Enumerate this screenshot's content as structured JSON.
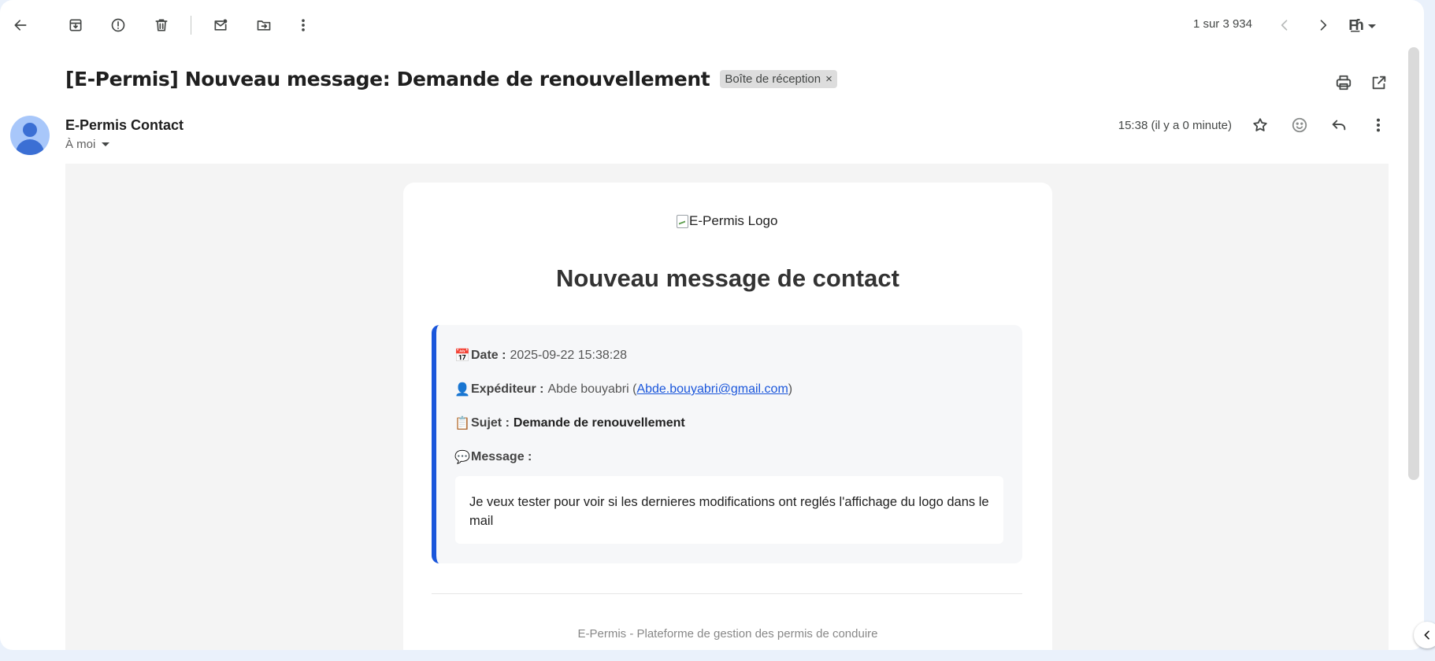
{
  "toolbar": {
    "back_icon": "arrow-left-icon",
    "archive_icon": "archive-icon",
    "spam_icon": "report-spam-icon",
    "delete_icon": "trash-icon",
    "mark_unread_icon": "mark-unread-icon",
    "move_icon": "move-to-folder-icon",
    "more_icon": "more-vertical-icon",
    "pager_text": "1 sur 3 934",
    "prev_icon": "chevron-left-icon",
    "next_icon": "chevron-right-icon",
    "input_tools_glyph": "F͟ɦ"
  },
  "subject": {
    "title": "[E-Permis] Nouveau message: Demande de renouvellement",
    "label": "Boîte de réception",
    "label_remove": "×",
    "print_icon": "print-icon",
    "new_window_icon": "open-in-new-window-icon"
  },
  "sender": {
    "name": "E-Permis Contact",
    "to": "À moi",
    "timestamp": "15:38 (il y a 0 minute)",
    "star_icon": "star-icon",
    "emoji_icon": "emoji-icon",
    "reply_icon": "reply-icon",
    "more_icon": "more-vertical-icon"
  },
  "email": {
    "logo_alt": "E-Permis Logo",
    "heading": "Nouveau message de contact",
    "date_emoji": "📅",
    "date_label": "Date :",
    "date_value": "2025-09-22 15:38:28",
    "sender_emoji": "👤",
    "sender_label": "Expéditeur :",
    "sender_name": "Abde bouyabri (",
    "sender_email": "Abde.bouyabri@gmail.com",
    "sender_close": ")",
    "subject_emoji": "📋",
    "subject_label": "Sujet :",
    "subject_value": "Demande de renouvellement",
    "message_emoji": "💬",
    "message_label": "Message :",
    "message_body": "Je veux tester pour voir si les dernieres modifications ont reglés l'affichage du logo dans le mail",
    "footer": "E-Permis - Plateforme de gestion des permis de conduire"
  },
  "colors": {
    "accent": "#1a56db",
    "app_background": "#eaf1fb",
    "mail_background": "#f4f4f4",
    "avatar": "#a8c7fa"
  }
}
